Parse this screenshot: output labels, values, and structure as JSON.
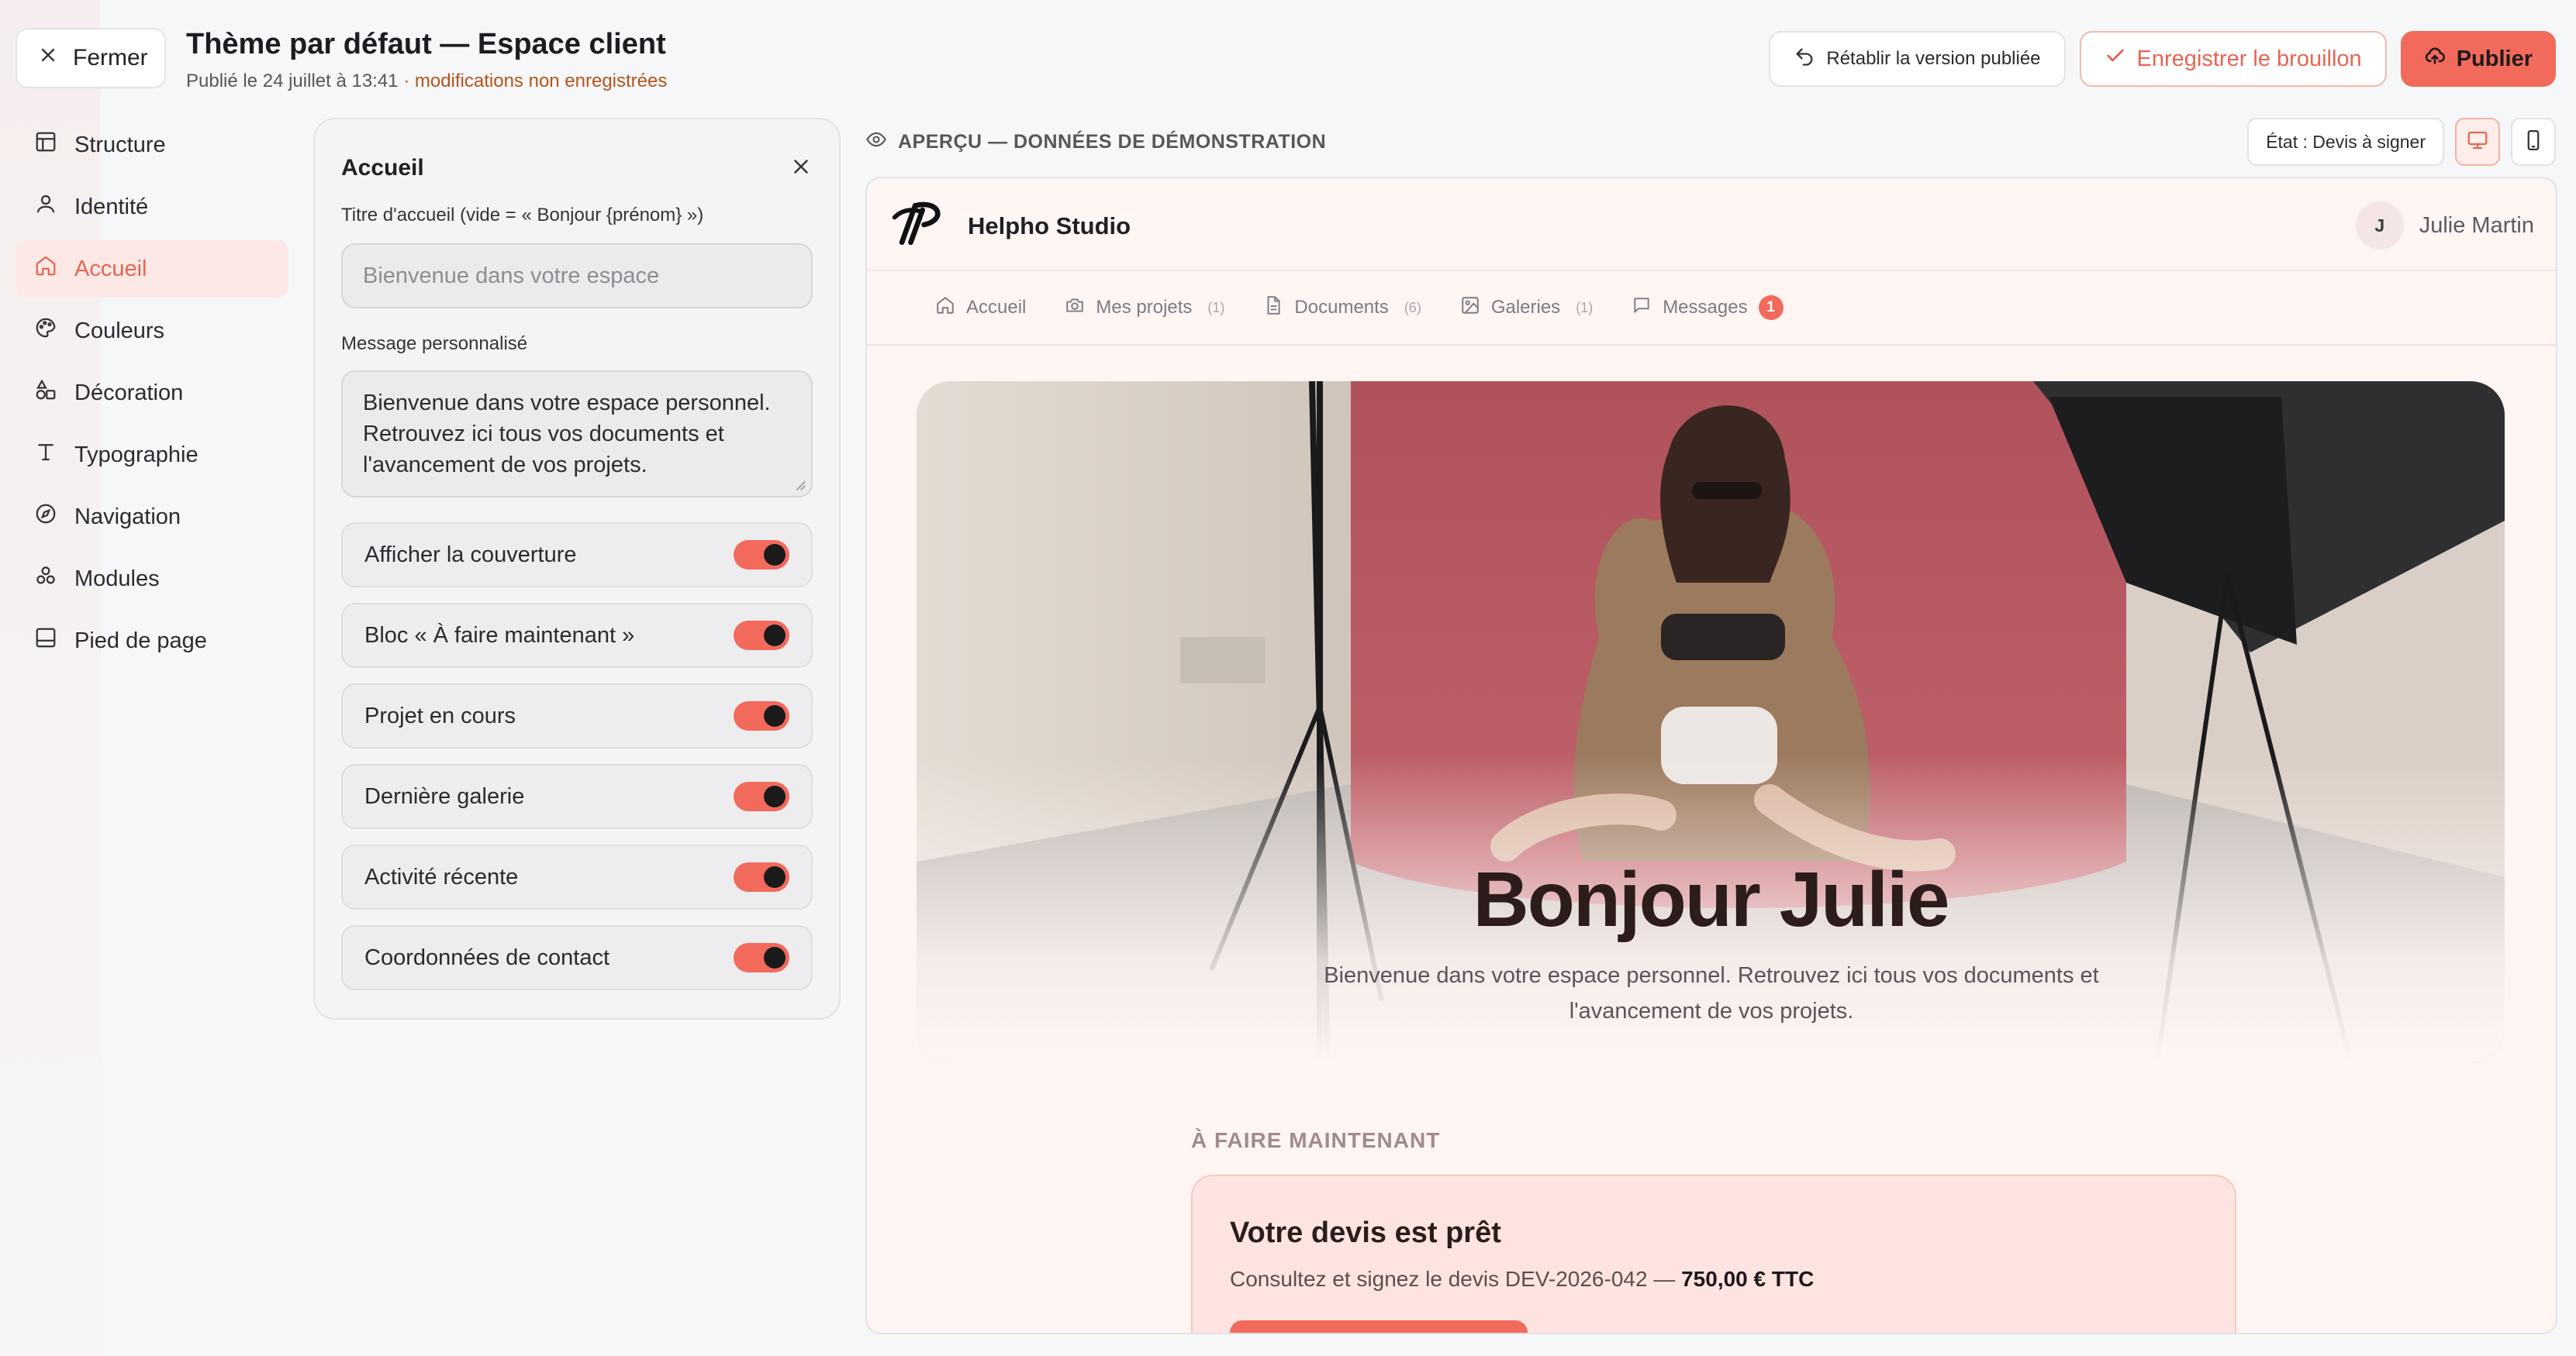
{
  "header": {
    "close_label": "Fermer",
    "title": "Thème par défaut — Espace client",
    "published": "Publié le 24 juillet à 13:41",
    "unsaved": " · modifications non enregistrées",
    "restore_label": "Rétablir la version publiée",
    "draft_label": "Enregistrer le brouillon",
    "publish_label": "Publier"
  },
  "sidebar": {
    "items": [
      {
        "label": "Structure",
        "icon": "layout-icon"
      },
      {
        "label": "Identité",
        "icon": "user-icon"
      },
      {
        "label": "Accueil",
        "icon": "home-icon",
        "active": true
      },
      {
        "label": "Couleurs",
        "icon": "palette-icon"
      },
      {
        "label": "Décoration",
        "icon": "shapes-icon"
      },
      {
        "label": "Typographie",
        "icon": "type-icon"
      },
      {
        "label": "Navigation",
        "icon": "compass-icon"
      },
      {
        "label": "Modules",
        "icon": "modules-icon"
      },
      {
        "label": "Pied de page",
        "icon": "footer-icon"
      }
    ]
  },
  "panel": {
    "title": "Accueil",
    "welcome_label": "Titre d'accueil (vide = « Bonjour {prénom} »)",
    "welcome_placeholder": "Bienvenue dans votre espace",
    "message_label": "Message personnalisé",
    "message_value": "Bienvenue dans votre espace personnel. Retrouvez ici tous vos documents et l'avancement de vos projets.",
    "toggles": [
      {
        "label": "Afficher la couverture",
        "on": true
      },
      {
        "label": "Bloc « À faire maintenant »",
        "on": true
      },
      {
        "label": "Projet en cours",
        "on": true
      },
      {
        "label": "Dernière galerie",
        "on": true
      },
      {
        "label": "Activité récente",
        "on": true
      },
      {
        "label": "Coordonnées de contact",
        "on": true
      }
    ]
  },
  "preview": {
    "label": "APERÇU — DONNÉES DE DÉMONSTRATION",
    "state": "État : Devis à signer",
    "studio_name": "Helpho Studio",
    "user_initial": "J",
    "user_name": "Julie Martin",
    "tabs": [
      {
        "label": "Accueil",
        "icon": "home-icon",
        "count": ""
      },
      {
        "label": "Mes projets",
        "icon": "camera-icon",
        "count": "(1)"
      },
      {
        "label": "Documents",
        "icon": "document-icon",
        "count": "(6)"
      },
      {
        "label": "Galeries",
        "icon": "image-icon",
        "count": "(1)"
      },
      {
        "label": "Messages",
        "icon": "message-icon",
        "count": "",
        "badge": "1"
      }
    ],
    "hero_title": "Bonjour Julie",
    "hero_text": "Bienvenue dans votre espace personnel. Retrouvez ici tous vos documents et l'avancement de vos projets.",
    "todo_label": "À FAIRE MAINTENANT",
    "todo_title": "Votre devis est prêt",
    "todo_sub": "Consultez et signez le devis DEV-2026-042 —",
    "todo_amount": "750,00 € TTC"
  },
  "colors": {
    "accent": "#f26a5b",
    "accent_soft": "#fce9e6",
    "unsaved_text": "#b4541a"
  }
}
